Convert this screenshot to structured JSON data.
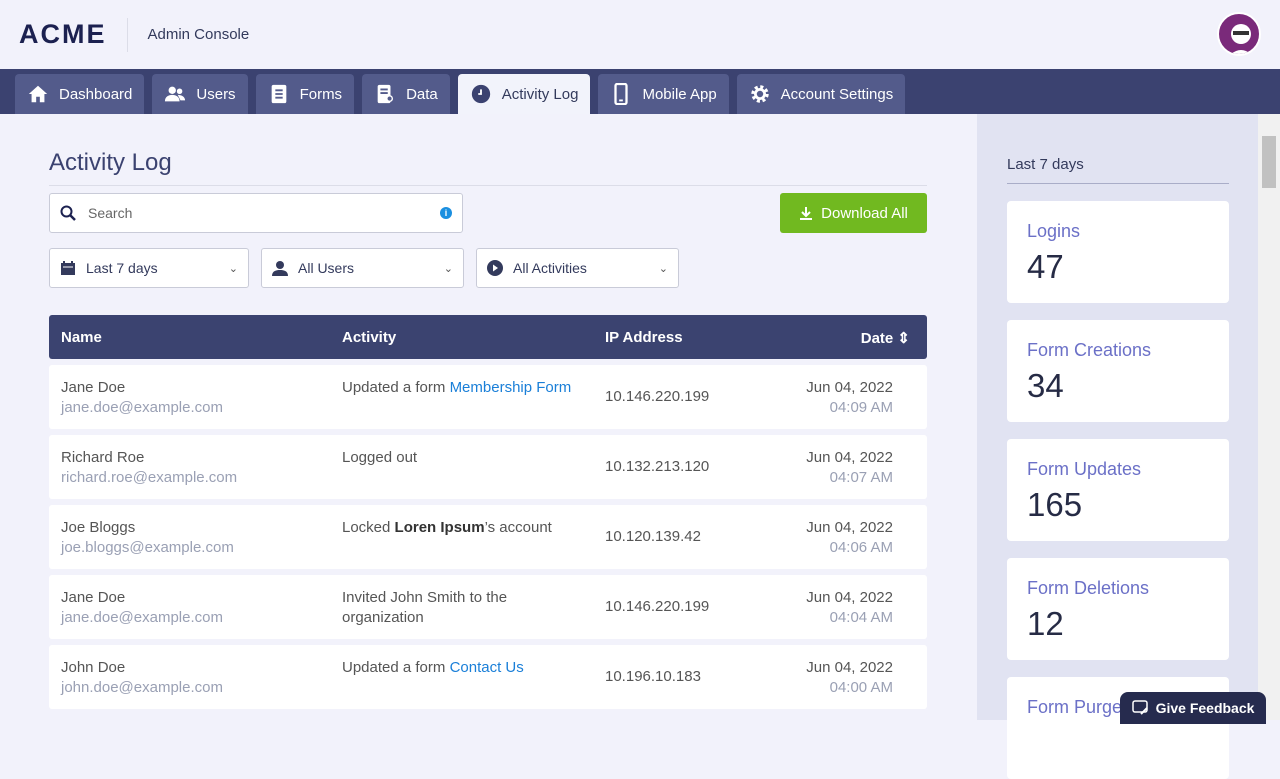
{
  "header": {
    "logo": "ACME",
    "app_title": "Admin Console"
  },
  "nav": {
    "tabs": [
      {
        "label": "Dashboard"
      },
      {
        "label": "Users"
      },
      {
        "label": "Forms"
      },
      {
        "label": "Data"
      },
      {
        "label": "Activity Log",
        "active": true
      },
      {
        "label": "Mobile App"
      },
      {
        "label": "Account Settings"
      }
    ]
  },
  "page": {
    "title": "Activity Log",
    "search_placeholder": "Search",
    "download_label": "Download All",
    "filters": {
      "date": "Last 7 days",
      "users": "All Users",
      "activities": "All Activities"
    }
  },
  "table": {
    "headers": {
      "name": "Name",
      "activity": "Activity",
      "ip": "IP Address",
      "date": "Date"
    },
    "rows": [
      {
        "name": "Jane Doe",
        "email": "jane.doe@example.com",
        "act_pre": "Updated a form ",
        "act_link": "Membership Form",
        "act_bold": "",
        "act_post": "",
        "ip": "10.146.220.199",
        "date": "Jun 04, 2022",
        "time": "04:09 AM"
      },
      {
        "name": "Richard Roe",
        "email": "richard.roe@example.com",
        "act_pre": "Logged out",
        "act_link": "",
        "act_bold": "",
        "act_post": "",
        "ip": "10.132.213.120",
        "date": "Jun 04, 2022",
        "time": "04:07 AM"
      },
      {
        "name": "Joe Bloggs",
        "email": "joe.bloggs@example.com",
        "act_pre": "Locked ",
        "act_link": "",
        "act_bold": "Loren Ipsum",
        "act_post": "’s account",
        "ip": "10.120.139.42",
        "date": "Jun 04, 2022",
        "time": "04:06 AM"
      },
      {
        "name": "Jane Doe",
        "email": "jane.doe@example.com",
        "act_pre": "Invited John Smith to the organization",
        "act_link": "",
        "act_bold": "",
        "act_post": "",
        "ip": "10.146.220.199",
        "date": "Jun 04, 2022",
        "time": "04:04 AM"
      },
      {
        "name": "John Doe",
        "email": "john.doe@example.com",
        "act_pre": "Updated a form ",
        "act_link": "Contact Us",
        "act_bold": "",
        "act_post": "",
        "ip": "10.196.10.183",
        "date": "Jun 04, 2022",
        "time": "04:00 AM"
      }
    ]
  },
  "sidebar": {
    "period": "Last 7 days",
    "stats": [
      {
        "label": "Logins",
        "value": "47"
      },
      {
        "label": "Form Creations",
        "value": "34"
      },
      {
        "label": "Form Updates",
        "value": "165"
      },
      {
        "label": "Form Deletions",
        "value": "12"
      },
      {
        "label": "Form Purges",
        "value": ""
      }
    ]
  },
  "feedback": {
    "label": "Give Feedback"
  }
}
